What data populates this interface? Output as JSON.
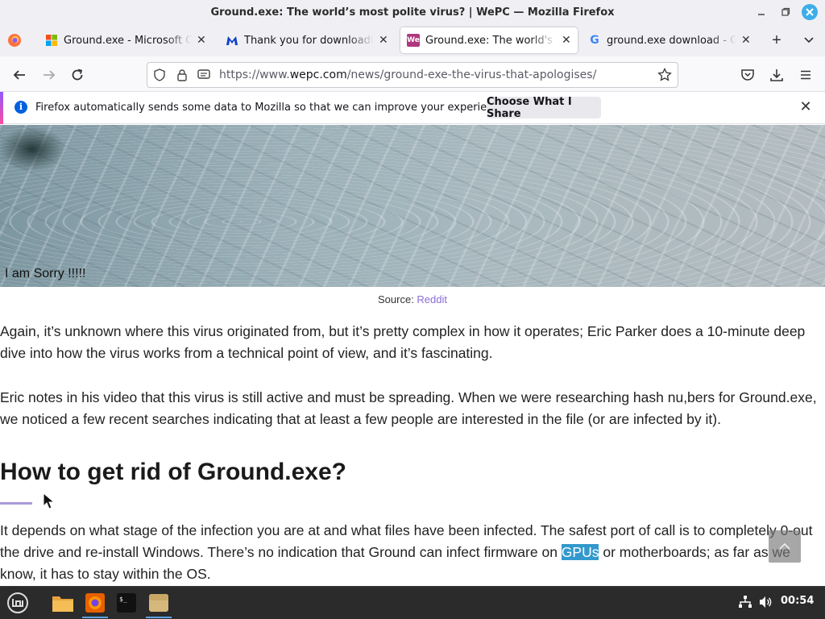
{
  "window": {
    "title": "Ground.exe: The world’s most polite virus? | WePC — Mozilla Firefox",
    "close_icon": "close-icon",
    "minimize_icon": "minimize-icon",
    "maximize_icon": "maximize-icon"
  },
  "tabs": [
    {
      "label": "Ground.exe - Microsoft Community",
      "icon": "microsoft-icon",
      "active": false
    },
    {
      "label": "Thank you for downloading",
      "icon": "malwarebytes-icon",
      "active": false
    },
    {
      "label": "Ground.exe: The world's most polite virus?",
      "icon": "wepc-icon",
      "active": true
    },
    {
      "label": "ground.exe download - Google Search",
      "icon": "google-icon",
      "active": false
    }
  ],
  "navbar": {
    "url_prefix": "https://www.",
    "url_host": "wepc.com",
    "url_path": "/news/ground-exe-the-virus-that-apologises/"
  },
  "notification": {
    "text": "Firefox automatically sends some data to Mozilla so that we can improve your experience.",
    "button_label": "Choose What I Share"
  },
  "article": {
    "image_caption": "I am Sorry !!!!!",
    "source_label": "Source: ",
    "source_link": "Reddit",
    "paragraph_1": "Again, it’s unknown where this virus originated from, but it’s pretty complex in how it operates; Eric Parker does a 10-minute deep dive into how the virus works from a technical point of view, and it’s fascinating.",
    "paragraph_2": "Eric notes in his video that this virus is still active and must be spreading. When we were researching hash nu,bers for Ground.exe, we noticed a few recent searches indicating that at least a few people are interested in the file (or are infected by it).",
    "heading": "How to get rid of Ground.exe?",
    "paragraph_3_before": "It depends on what stage of the infection you are at and what files have been infected. The safest port of call is to completely 0-out the drive and re-install Windows. There’s no indication that Ground can infect firmware on ",
    "paragraph_3_highlight": "GPUs",
    "paragraph_3_after": " or motherboards; as far as we know, it has to stay within the OS."
  },
  "taskbar": {
    "clock": "00:54",
    "items": [
      "mint-menu-icon",
      "files-icon",
      "firefox-icon",
      "terminal-icon",
      "archive-icon"
    ]
  },
  "colors": {
    "link": "#8a6fd6",
    "highlight": "#3399cc",
    "close_button": "#3daee9"
  }
}
